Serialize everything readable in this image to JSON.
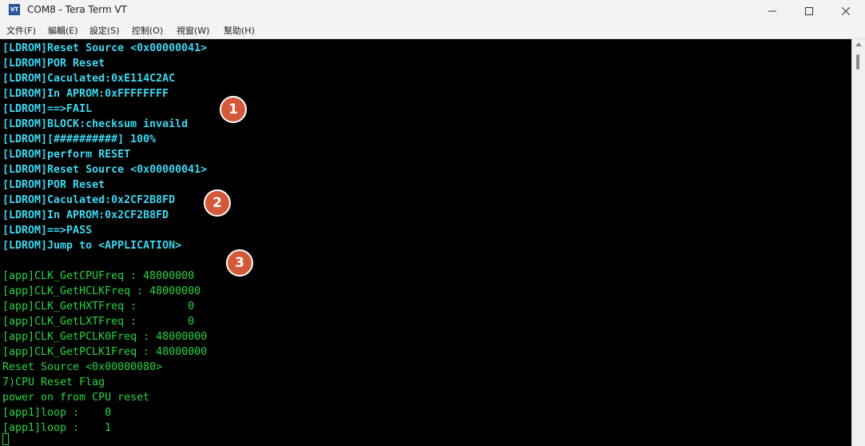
{
  "window": {
    "title": "COM8 - Tera Term VT",
    "icon": "VT"
  },
  "menu": [
    {
      "label": "文件(F)"
    },
    {
      "label": "編輯(E)"
    },
    {
      "label": "設定(S)"
    },
    {
      "label": "控制(O)"
    },
    {
      "label": "視窗(W)"
    },
    {
      "label": "幫助(H)"
    }
  ],
  "terminal": {
    "colors": {
      "ldrom": "#3cd8f2",
      "app": "#27d642",
      "background": "#000000"
    },
    "lines": [
      {
        "text": "[LDROM]Reset Source <0x00000041>",
        "style": "cyan"
      },
      {
        "text": "[LDROM]POR Reset",
        "style": "cyan"
      },
      {
        "text": "[LDROM]Caculated:0xE114C2AC",
        "style": "cyan"
      },
      {
        "text": "[LDROM]In APROM:0xFFFFFFFF",
        "style": "cyan"
      },
      {
        "text": "[LDROM]==>FAIL",
        "style": "cyan"
      },
      {
        "text": "[LDROM]BLOCK:checksum invaild",
        "style": "cyan"
      },
      {
        "text": "[LDROM][##########] 100%",
        "style": "cyan"
      },
      {
        "text": "[LDROM]perform RESET",
        "style": "cyan"
      },
      {
        "text": "[LDROM]Reset Source <0x00000041>",
        "style": "cyan"
      },
      {
        "text": "[LDROM]POR Reset",
        "style": "cyan"
      },
      {
        "text": "[LDROM]Caculated:0x2CF2B8FD",
        "style": "cyan"
      },
      {
        "text": "[LDROM]In APROM:0x2CF2B8FD",
        "style": "cyan"
      },
      {
        "text": "[LDROM]==>PASS",
        "style": "cyan"
      },
      {
        "text": "[LDROM]Jump to <APPLICATION>",
        "style": "cyan"
      },
      {
        "text": "",
        "style": "green"
      },
      {
        "text": "[app]CLK_GetCPUFreq : 48000000",
        "style": "green"
      },
      {
        "text": "[app]CLK_GetHCLKFreq : 48000000",
        "style": "green"
      },
      {
        "text": "[app]CLK_GetHXTFreq :        0",
        "style": "green"
      },
      {
        "text": "[app]CLK_GetLXTFreq :        0",
        "style": "green"
      },
      {
        "text": "[app]CLK_GetPCLK0Freq : 48000000",
        "style": "green"
      },
      {
        "text": "[app]CLK_GetPCLK1Freq : 48000000",
        "style": "green"
      },
      {
        "text": "Reset Source <0x00000080>",
        "style": "green"
      },
      {
        "text": "7)CPU Reset Flag",
        "style": "green"
      },
      {
        "text": "power on from CPU reset",
        "style": "green"
      },
      {
        "text": "[app1]loop :    0",
        "style": "green"
      },
      {
        "text": "[app1]loop :    1",
        "style": "green"
      }
    ]
  },
  "annotations": [
    {
      "label": "1"
    },
    {
      "label": "2"
    },
    {
      "label": "3"
    }
  ]
}
